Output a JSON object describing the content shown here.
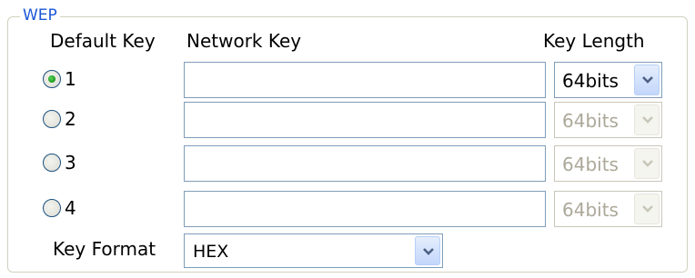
{
  "group_title": "WEP",
  "headers": {
    "default_key": "Default Key",
    "network_key": "Network Key",
    "key_length": "Key Length"
  },
  "keys": [
    {
      "label": "1",
      "selected": true,
      "network_key": "",
      "key_length": "64bits",
      "enabled": true
    },
    {
      "label": "2",
      "selected": false,
      "network_key": "",
      "key_length": "64bits",
      "enabled": false
    },
    {
      "label": "3",
      "selected": false,
      "network_key": "",
      "key_length": "64bits",
      "enabled": false
    },
    {
      "label": "4",
      "selected": false,
      "network_key": "",
      "key_length": "64bits",
      "enabled": false
    }
  ],
  "key_format": {
    "label": "Key Format",
    "value": "HEX"
  },
  "icons": {
    "dropdown": "chevron-down-icon",
    "radio_selected": "radio-selected-icon"
  },
  "colors": {
    "accent": "#1c57d8",
    "radio_dot": "#21a121",
    "field_border": "#7f9db9",
    "disabled_text": "#aca899"
  }
}
